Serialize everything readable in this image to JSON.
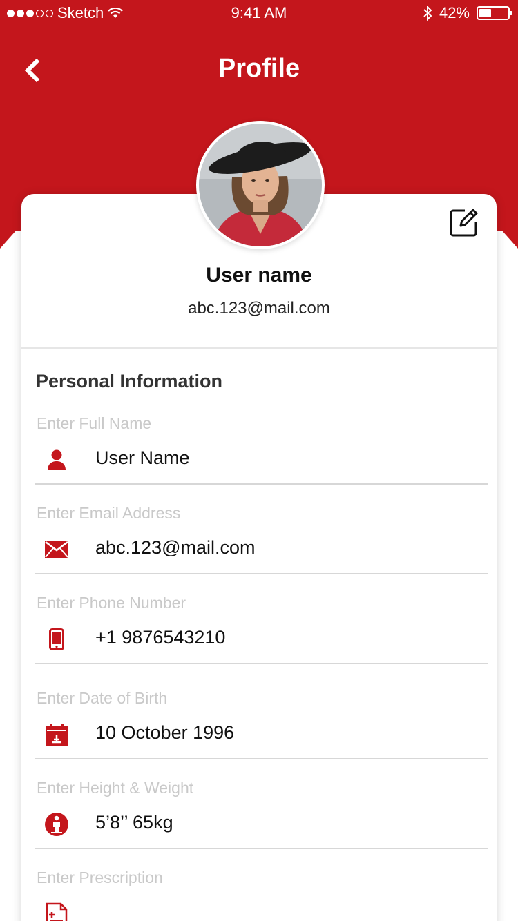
{
  "status_bar": {
    "carrier": "Sketch",
    "time": "9:41 AM",
    "battery_percent": "42%",
    "battery_level": 0.42
  },
  "nav": {
    "title": "Profile",
    "back_icon": "chevron-left-icon"
  },
  "profile": {
    "name": "User name",
    "email": "abc.123@mail.com",
    "edit_icon": "edit-icon"
  },
  "section": {
    "title": "Personal Information"
  },
  "fields": [
    {
      "label": "Enter Full Name",
      "value": "User Name",
      "icon": "user-icon"
    },
    {
      "label": "Enter Email Address",
      "value": "abc.123@mail.com",
      "icon": "mail-icon"
    },
    {
      "label": "Enter Phone Number",
      "value": "+1 9876543210",
      "icon": "phone-icon"
    },
    {
      "label": "Enter Date of Birth",
      "value": "10 October 1996",
      "icon": "calendar-icon"
    },
    {
      "label": "Enter Height & Weight",
      "value": "5’8’’ 65kg",
      "icon": "body-measure-icon"
    },
    {
      "label": "Enter Prescription",
      "value": "",
      "icon": "prescription-icon"
    }
  ],
  "colors": {
    "accent": "#c4161c",
    "label": "#c9c9c9",
    "text": "#111111"
  }
}
